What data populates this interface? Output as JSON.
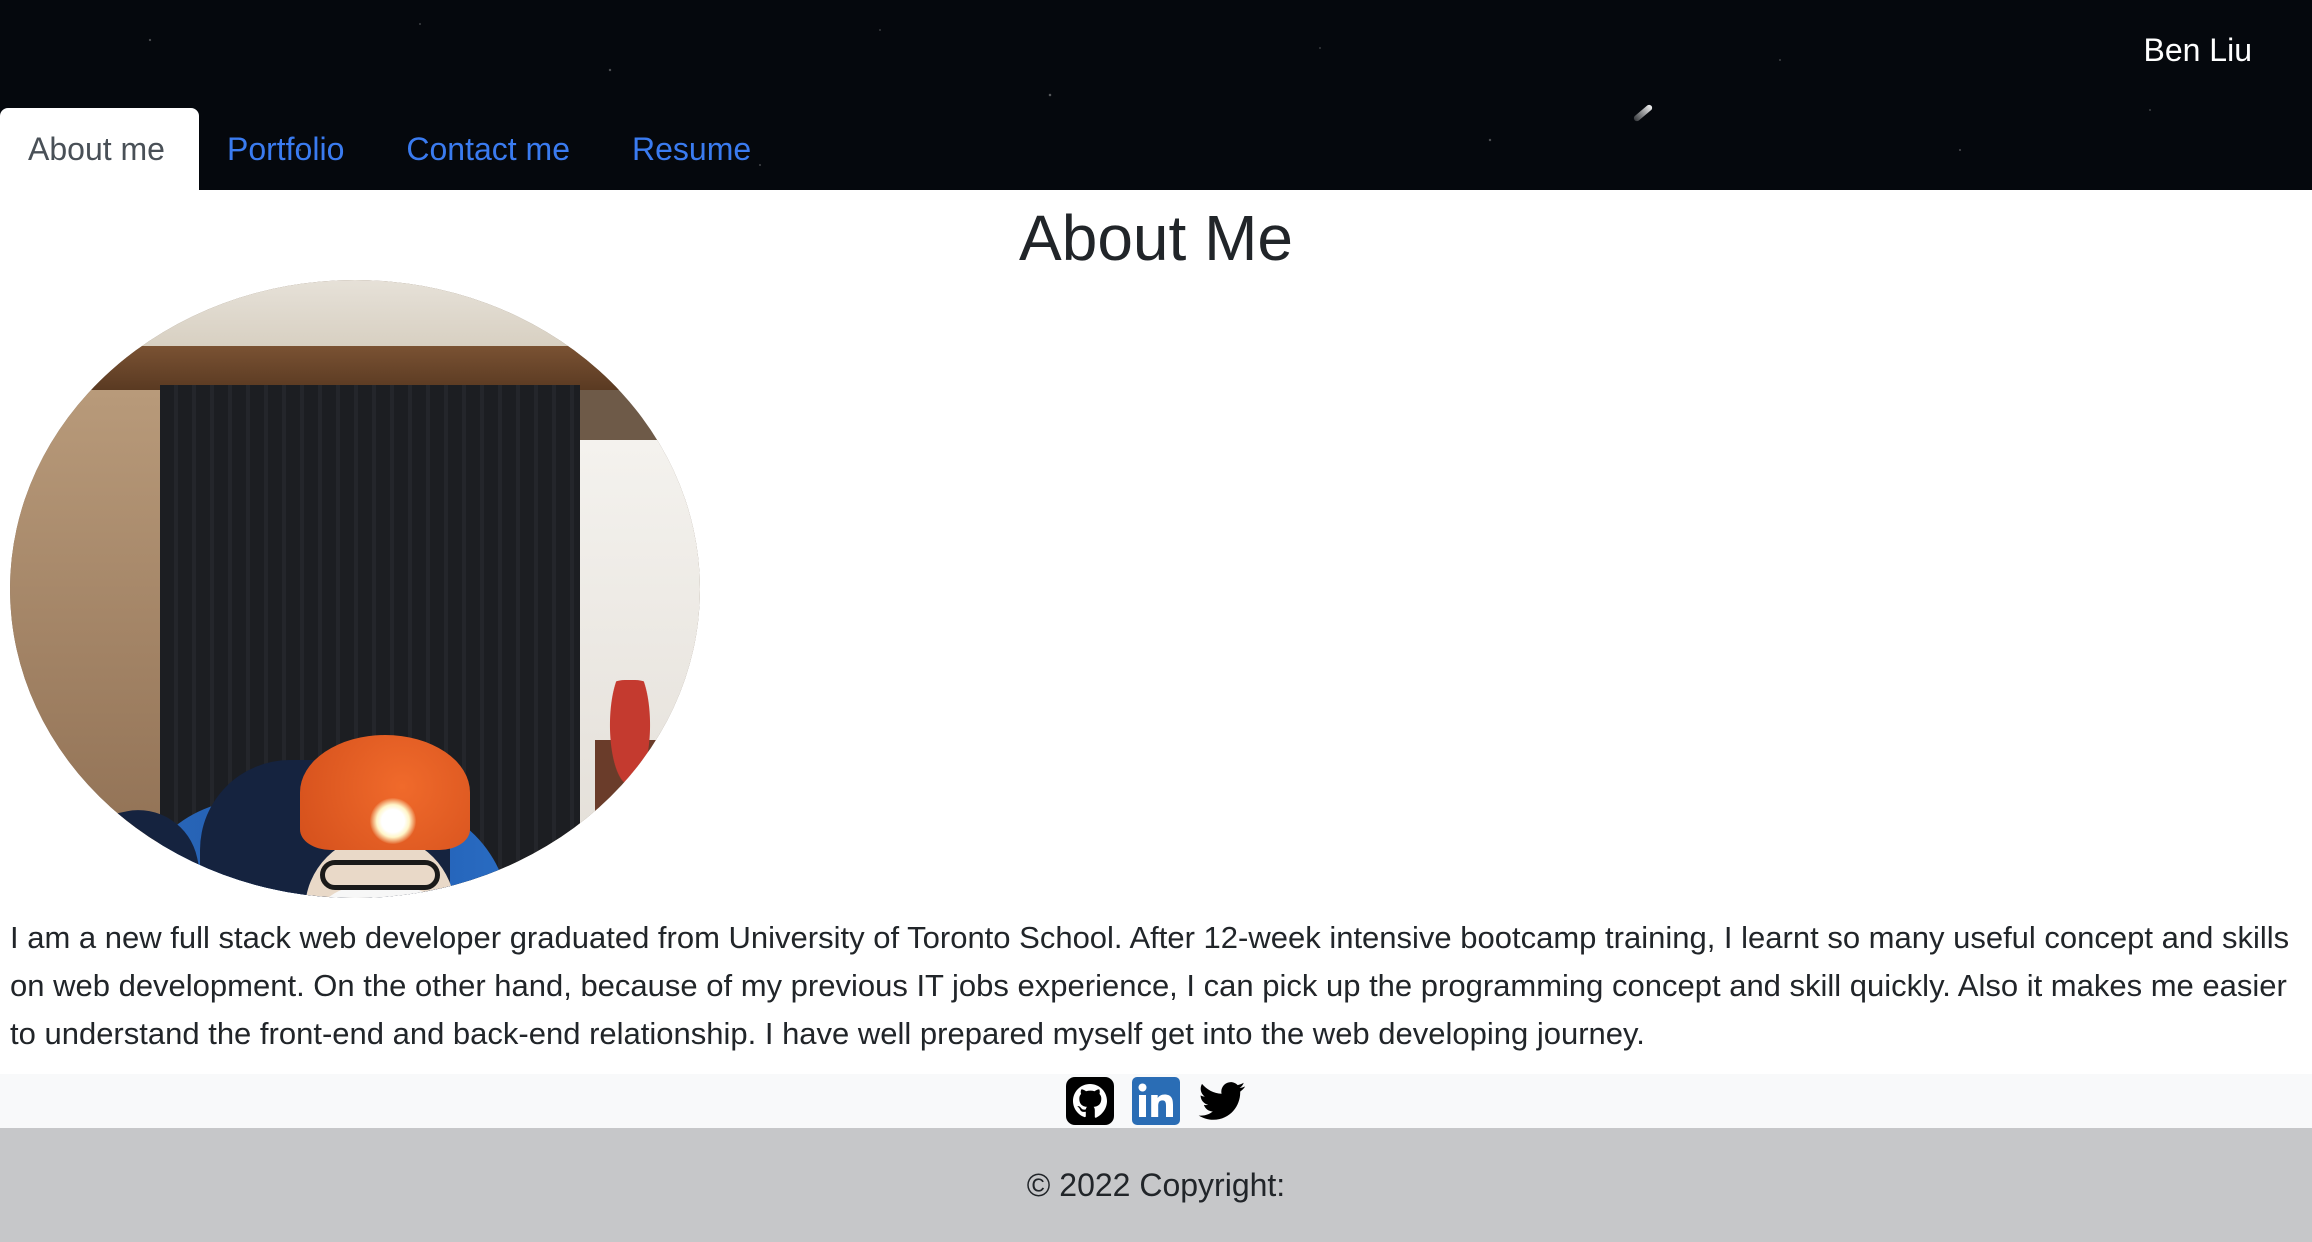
{
  "header": {
    "brand": "Ben Liu"
  },
  "nav": {
    "tabs": [
      {
        "label": "About me",
        "active": true
      },
      {
        "label": "Portfolio",
        "active": false
      },
      {
        "label": "Contact me",
        "active": false
      },
      {
        "label": "Resume",
        "active": false
      }
    ]
  },
  "main": {
    "title": "About Me",
    "bio": "I am a new full stack web developer graduated from University of Toronto School. After 12-week intensive bootcamp training, I learnt so many useful concept and skills on web development. On the other hand, because of my previous IT jobs experience, I can pick up the programming concept and skill quickly. Also it makes me easier to understand the front-end and back-end relationship. I have well prepared myself get into the web developing journey."
  },
  "social": {
    "icons": [
      {
        "name": "github-icon",
        "color": "#000000"
      },
      {
        "name": "linkedin-icon",
        "color": "#2a6db5"
      },
      {
        "name": "twitter-icon",
        "color": "#000000"
      }
    ]
  },
  "footer": {
    "copyright": "© 2022 Copyright:"
  },
  "colors": {
    "header_bg": "#05080d",
    "tab_link": "#3a7bf0",
    "tab_active_text": "#495057",
    "footer_bg": "#c6c7c9",
    "social_bar_bg": "#f8f9fa"
  }
}
